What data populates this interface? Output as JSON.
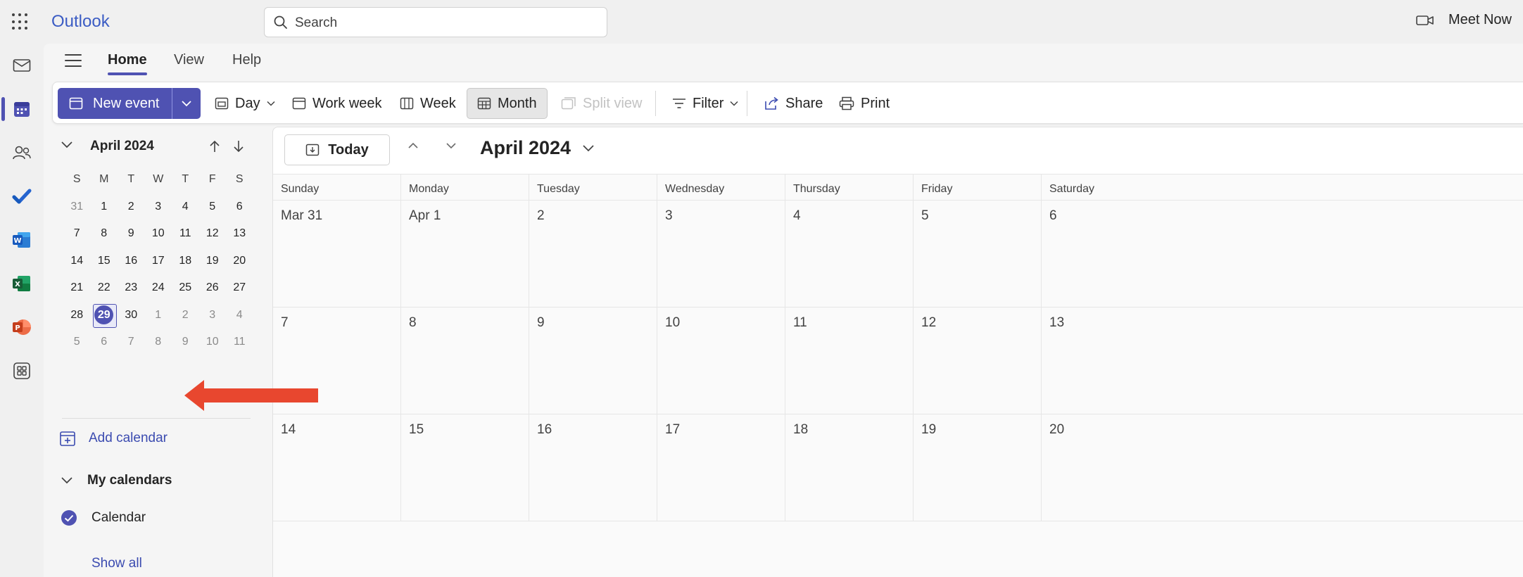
{
  "app": {
    "name": "Outlook"
  },
  "search": {
    "placeholder": "Search"
  },
  "meet_now": {
    "label": "Meet Now"
  },
  "tabs": [
    {
      "label": "Home",
      "active": true
    },
    {
      "label": "View",
      "active": false
    },
    {
      "label": "Help",
      "active": false
    }
  ],
  "ribbon": {
    "new_event": "New event",
    "day": "Day",
    "work_week": "Work week",
    "week": "Week",
    "month": "Month",
    "split_view": "Split view",
    "filter": "Filter",
    "share": "Share",
    "print": "Print"
  },
  "mini_calendar": {
    "title": "April 2024",
    "weekdays": [
      "S",
      "M",
      "T",
      "W",
      "T",
      "F",
      "S"
    ],
    "weeks": [
      [
        "31",
        "1",
        "2",
        "3",
        "4",
        "5",
        "6"
      ],
      [
        "7",
        "8",
        "9",
        "10",
        "11",
        "12",
        "13"
      ],
      [
        "14",
        "15",
        "16",
        "17",
        "18",
        "19",
        "20"
      ],
      [
        "21",
        "22",
        "23",
        "24",
        "25",
        "26",
        "27"
      ],
      [
        "28",
        "29",
        "30",
        "1",
        "2",
        "3",
        "4"
      ],
      [
        "5",
        "6",
        "7",
        "8",
        "9",
        "10",
        "11"
      ]
    ],
    "selected_day": "29"
  },
  "nav": {
    "add_calendar": "Add calendar",
    "my_calendars": "My calendars",
    "calendar_item": "Calendar",
    "show_all": "Show all"
  },
  "calendar": {
    "today_label": "Today",
    "month_title": "April 2024",
    "day_headers": [
      "Sunday",
      "Monday",
      "Tuesday",
      "Wednesday",
      "Thursday",
      "Friday",
      "Saturday"
    ],
    "weeks": [
      [
        "Mar 31",
        "Apr 1",
        "2",
        "3",
        "4",
        "5",
        "6"
      ],
      [
        "7",
        "8",
        "9",
        "10",
        "11",
        "12",
        "13"
      ],
      [
        "14",
        "15",
        "16",
        "17",
        "18",
        "19",
        "20"
      ]
    ]
  },
  "colors": {
    "accent": "#4f52b2",
    "annotation_arrow": "#e8472f",
    "link": "#3b4bb0"
  }
}
